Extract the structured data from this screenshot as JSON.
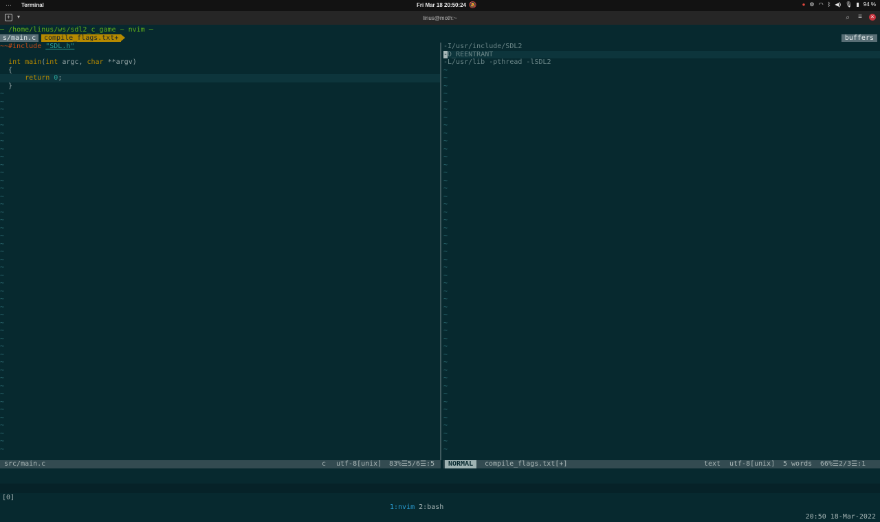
{
  "topbar": {
    "app_name": "Terminal",
    "datetime": "Fri Mar 18  20:50:24",
    "battery": "94 %",
    "tray_icons": [
      "record-icon",
      "settings-icon",
      "wifi-icon",
      "bluetooth-icon",
      "volume-icon",
      "mic-icon",
      "battery-icon"
    ]
  },
  "window": {
    "title": "linus@moth:~"
  },
  "tmux_pane_title": "─ /home/linus/ws/sdl2_c_game ~ nvim ─",
  "bufferline": {
    "tab1": "s/main.c",
    "tab2": "compile_flags.txt+",
    "buffers_label": "buffers"
  },
  "left_pane": {
    "lines": [
      {
        "parts": [
          {
            "t": "~~",
            "c": "pre"
          },
          {
            "t": "#include ",
            "c": "pre"
          },
          {
            "t": "\"SDL.h\"",
            "c": "str"
          }
        ]
      },
      {
        "parts": [
          {
            "t": "",
            "c": "plain"
          }
        ]
      },
      {
        "parts": [
          {
            "t": "  ",
            "c": "plain"
          },
          {
            "t": "int ",
            "c": "kw"
          },
          {
            "t": "main",
            "c": "fn"
          },
          {
            "t": "(",
            "c": "plain"
          },
          {
            "t": "int ",
            "c": "kw"
          },
          {
            "t": "argc, ",
            "c": "plain"
          },
          {
            "t": "char ",
            "c": "kw"
          },
          {
            "t": "**argv)",
            "c": "plain"
          }
        ]
      },
      {
        "parts": [
          {
            "t": "  {",
            "c": "plain"
          }
        ]
      },
      {
        "parts": [
          {
            "t": "      ",
            "c": "plain"
          },
          {
            "t": "return ",
            "c": "kw"
          },
          {
            "t": "0",
            "c": "str2"
          },
          {
            "t": ";",
            "c": "plain"
          }
        ],
        "cursorline": true
      },
      {
        "parts": [
          {
            "t": "  }",
            "c": "plain"
          }
        ]
      }
    ],
    "tilde_count": 47
  },
  "right_pane": {
    "lines": [
      {
        "parts": [
          {
            "t": "-I/usr/include/SDL2",
            "c": "dim"
          }
        ]
      },
      {
        "parts": [
          {
            "t": "-",
            "c": "cursor"
          },
          {
            "t": "D_REENTRANT",
            "c": "dim"
          }
        ],
        "cursorline": true
      },
      {
        "parts": [
          {
            "t": "-L/usr/lib -pthread -lSDL2",
            "c": "dim"
          }
        ]
      }
    ],
    "tilde_count": 51
  },
  "statusline_left": {
    "file": "src/main.c",
    "filetype": "c",
    "encoding": "utf-8[unix]",
    "position": "83%☰5/6☰:5"
  },
  "statusline_right": {
    "mode": "NORMAL",
    "file": "compile_flags.txt[+]",
    "filetype": "text",
    "encoding": "utf-8[unix]",
    "words": "5 words",
    "position": "66%☰2/3☰:1"
  },
  "tmux": {
    "session": "[0]",
    "window1": "1:nvim",
    "window2": "2:bash",
    "clock": "20:50 18-Mar-2022"
  }
}
